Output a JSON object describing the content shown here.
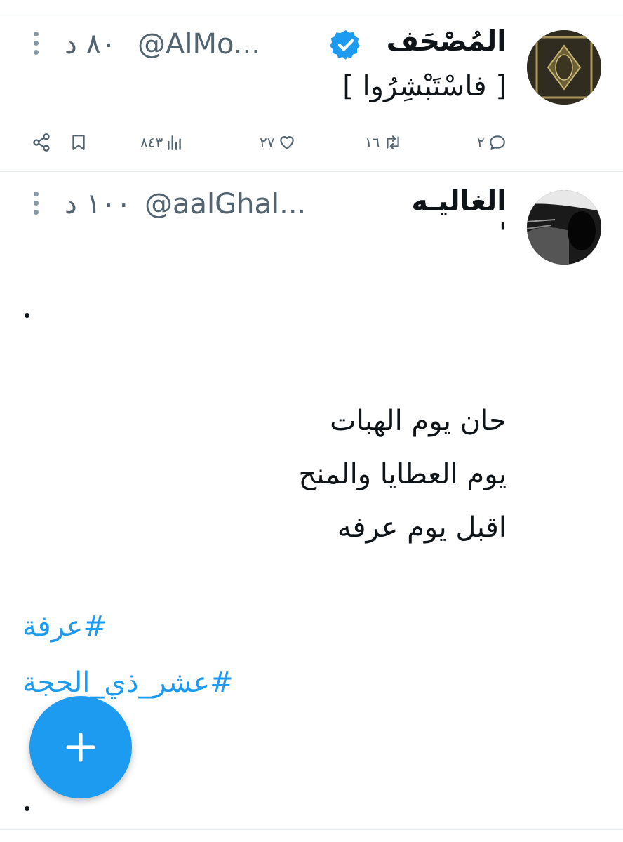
{
  "tweets": [
    {
      "display_name": "المُصْحَف",
      "handle": "@AlMo...",
      "time": "٨٠ د",
      "body": "[ فاسْتَبْشِرُوا ]",
      "actions": {
        "replies": "٢",
        "retweets": "١٦",
        "likes": "٢٧",
        "views": "٨٤٣"
      }
    },
    {
      "display_name": "الغاليـه",
      "handle": "@aalGhal...",
      "time": "١٠٠ د",
      "first_line": "'",
      "bullet_top": "•",
      "poem_lines": [
        "حان يوم الهبات",
        "يوم العطايا والمنح",
        "اقبل يوم عرفه"
      ],
      "hashtags": [
        "#عرفة",
        "#عشر_ذي_الحجة"
      ],
      "bullet_bottom": "•"
    }
  ],
  "colors": {
    "accent": "#1d9bf0",
    "muted": "#536471",
    "verified": "#1d9bf0"
  },
  "icons": [
    "share-icon",
    "bookmark-icon",
    "views-icon",
    "like-icon",
    "retweet-icon",
    "reply-icon",
    "more-icon",
    "verified-icon",
    "plus-icon"
  ]
}
